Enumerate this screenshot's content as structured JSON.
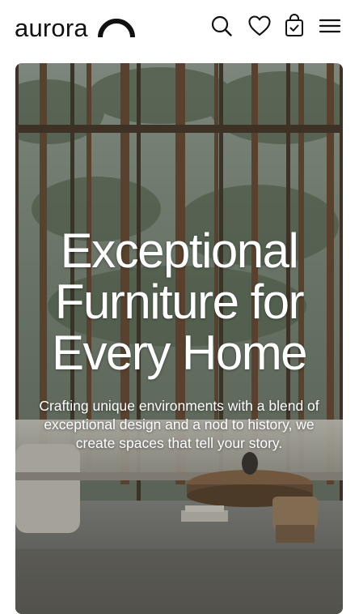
{
  "header": {
    "logo_text": "aurora",
    "icons": {
      "search": "search-icon",
      "wishlist": "heart-icon",
      "cart": "shopping-bag-icon",
      "menu": "hamburger-menu-icon"
    }
  },
  "hero": {
    "title_line1": "Exceptional",
    "title_line2": "Furniture for",
    "title_line3": "Every Home",
    "subtitle_line1": "Crafting unique environments with a blend of",
    "subtitle_line2": "exceptional design and a nod to history, we",
    "subtitle_line3": "create spaces that tell your story."
  },
  "colors": {
    "text_dark": "#111111",
    "background": "#ffffff",
    "hero_text": "#ffffff"
  }
}
